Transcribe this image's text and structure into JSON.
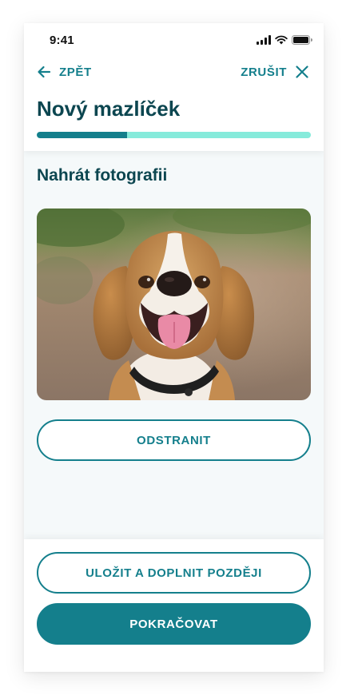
{
  "status_bar": {
    "time": "9:41"
  },
  "nav": {
    "back_label": "ZPĚT",
    "cancel_label": "ZRUŠIT"
  },
  "header": {
    "title": "Nový mazlíček",
    "progress_fraction": 0.33
  },
  "content": {
    "section_title": "Nahrát fotografii",
    "photo_subject": "beagle dog photo",
    "remove_button_label": "ODSTRANIT"
  },
  "footer": {
    "save_later_label": "ULOŽIT A DOPLNIT POZDĚJI",
    "continue_label": "POKRAČOVAT"
  },
  "colors": {
    "accent": "#147f8c",
    "title": "#0c4650",
    "progress_track": "#86ebdb",
    "background": "#f5f9fa"
  }
}
